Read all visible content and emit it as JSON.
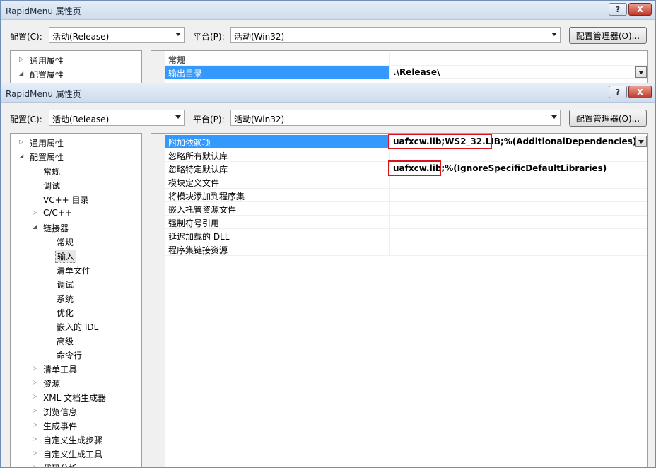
{
  "back_window": {
    "title": "RapidMenu 属性页",
    "help_label": "?",
    "close_label": "X",
    "config_label": "配置(C):",
    "config_value": "活动(Release)",
    "platform_label": "平台(P):",
    "platform_value": "活动(Win32)",
    "manager_label": "配置管理器(O)...",
    "tree": [
      {
        "label": "通用属性",
        "expander": "▷"
      },
      {
        "label": "配置属性",
        "expander": "◢"
      }
    ],
    "grid": {
      "category": "常规",
      "rows": [
        {
          "name": "输出目录",
          "value": ".\\Release\\"
        }
      ]
    }
  },
  "front_window": {
    "title": "RapidMenu 属性页",
    "help_label": "?",
    "close_label": "X",
    "config_label": "配置(C):",
    "config_value": "活动(Release)",
    "platform_label": "平台(P):",
    "platform_value": "活动(Win32)",
    "manager_label": "配置管理器(O)...",
    "tree": [
      {
        "label": "通用属性",
        "expander": "▷"
      },
      {
        "label": "配置属性",
        "expander": "◢"
      },
      {
        "label": "常规"
      },
      {
        "label": "调试"
      },
      {
        "label": "VC++ 目录"
      },
      {
        "label": "C/C++",
        "expander": "▷"
      },
      {
        "label": "链接器",
        "expander": "◢"
      },
      {
        "label": "常规"
      },
      {
        "label": "输入",
        "selected": true
      },
      {
        "label": "清单文件"
      },
      {
        "label": "调试"
      },
      {
        "label": "系统"
      },
      {
        "label": "优化"
      },
      {
        "label": "嵌入的 IDL"
      },
      {
        "label": "高级"
      },
      {
        "label": "命令行"
      },
      {
        "label": "清单工具",
        "expander": "▷"
      },
      {
        "label": "资源",
        "expander": "▷"
      },
      {
        "label": "XML 文档生成器",
        "expander": "▷"
      },
      {
        "label": "浏览信息",
        "expander": "▷"
      },
      {
        "label": "生成事件",
        "expander": "▷"
      },
      {
        "label": "自定义生成步骤",
        "expander": "▷"
      },
      {
        "label": "自定义生成工具",
        "expander": "▷"
      },
      {
        "label": "代码分析",
        "expander": "▷"
      }
    ],
    "grid": {
      "rows": [
        {
          "name": "附加依赖项",
          "value": "uafxcw.lib;WS2_32.LIB;%(AdditionalDependencies)",
          "selected": true
        },
        {
          "name": "忽略所有默认库",
          "value": ""
        },
        {
          "name": "忽略特定默认库",
          "value": "uafxcw.lib;%(IgnoreSpecificDefaultLibraries)"
        },
        {
          "name": "模块定义文件",
          "value": ""
        },
        {
          "name": "将模块添加到程序集",
          "value": ""
        },
        {
          "name": "嵌入托管资源文件",
          "value": ""
        },
        {
          "name": "强制符号引用",
          "value": ""
        },
        {
          "name": "延迟加载的 DLL",
          "value": ""
        },
        {
          "name": "程序集链接资源",
          "value": ""
        }
      ]
    }
  },
  "highlight_color": "#d9141c",
  "selection_color": "#3399ff"
}
